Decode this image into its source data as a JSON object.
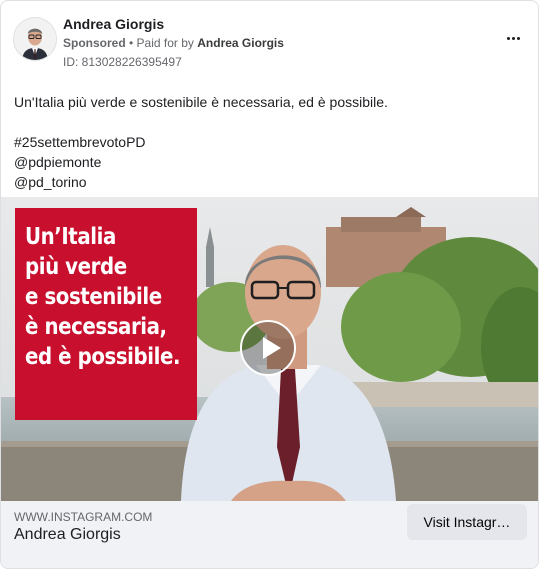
{
  "post": {
    "author_name": "Andrea Giorgis",
    "sponsored_label": "Sponsored",
    "separator": " • ",
    "paid_for_prefix": "Paid for by ",
    "payer_name": "Andrea Giorgis",
    "ad_id": "ID: 813028226395497",
    "more_icon": "more-horizontal-icon"
  },
  "body": {
    "line1": "Un'Italia più verde e sostenibile è necessaria, ed è possibile.",
    "hashtag": "#25settembrevotoPD",
    "mention1": "@pdpiemonte",
    "mention2": "@pd_torino"
  },
  "media": {
    "overlay_lines": [
      "Un’Italia",
      "più verde",
      "e sostenibile",
      "è necessaria,",
      "ed è possibile."
    ],
    "overlay_color": "#c8102e",
    "play_icon": "play-icon"
  },
  "link": {
    "domain": "WWW.INSTAGRAM.COM",
    "title": "Andrea Giorgis",
    "cta_label": "Visit Instagr…"
  }
}
